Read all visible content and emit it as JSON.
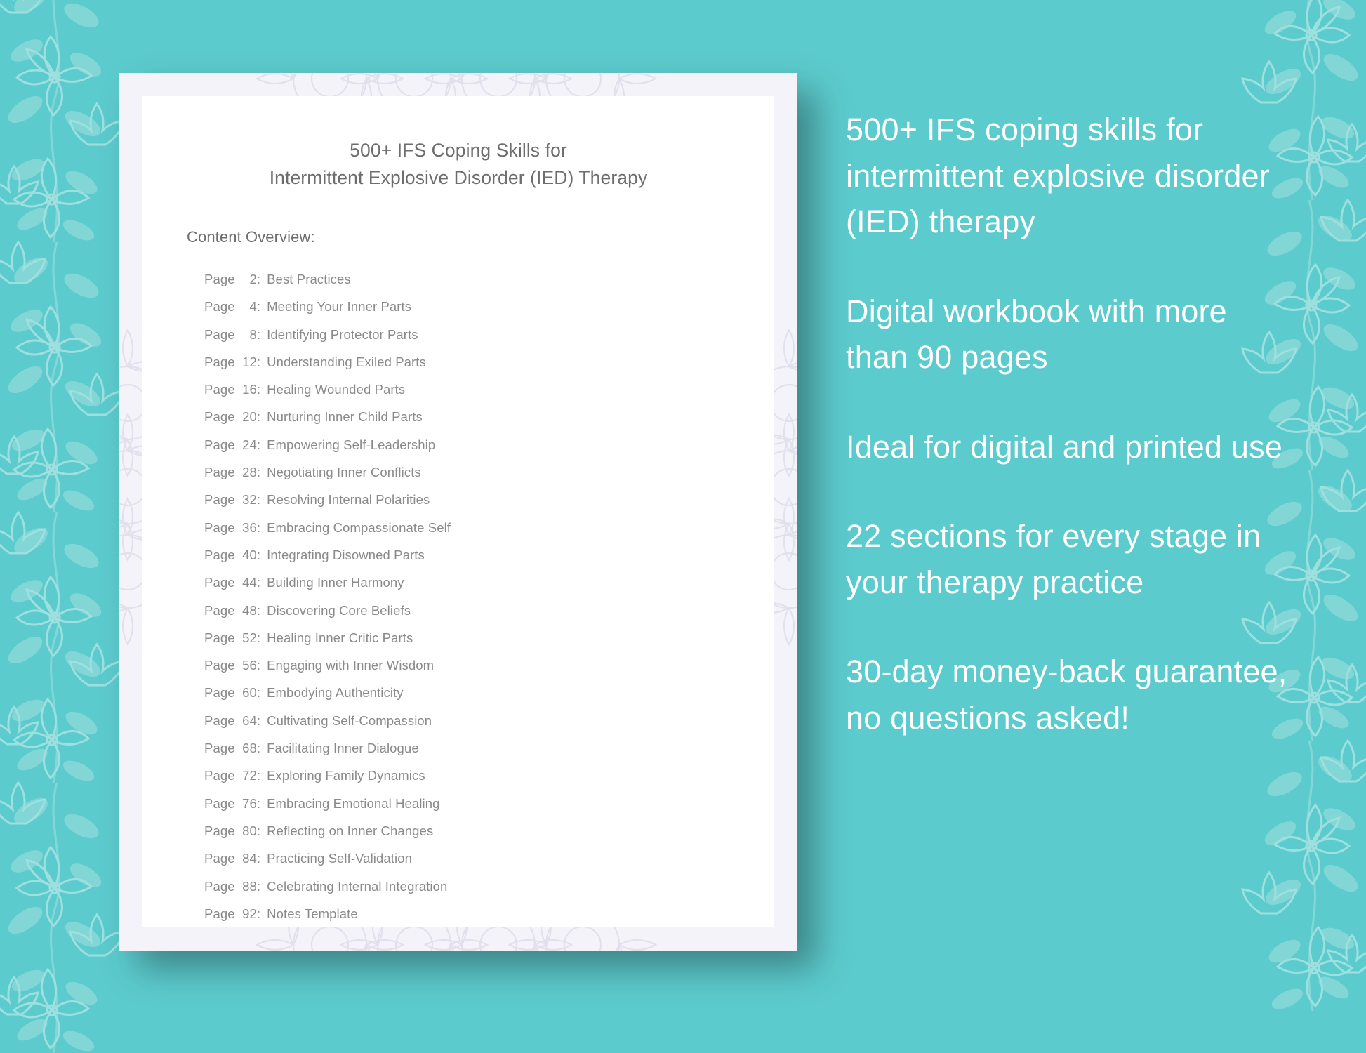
{
  "colors": {
    "background_teal": "#5ccbcd",
    "card_mat": "#f5f3fa",
    "page_white": "#ffffff",
    "title_text": "#6d6d6d",
    "toc_text": "#8a8a8a",
    "marketing_text": "#ffffff",
    "vine_ornament": "#a8e0de"
  },
  "document": {
    "title_line_1": "500+ IFS Coping Skills for",
    "title_line_2": "Intermittent Explosive Disorder (IED) Therapy",
    "content_overview_label": "Content Overview:",
    "toc": [
      {
        "page_label": "Page",
        "page": "2",
        "colon": ":",
        "title": "Best Practices"
      },
      {
        "page_label": "Page",
        "page": "4",
        "colon": ":",
        "title": "Meeting Your Inner Parts"
      },
      {
        "page_label": "Page",
        "page": "8",
        "colon": ":",
        "title": "Identifying Protector Parts"
      },
      {
        "page_label": "Page",
        "page": "12",
        "colon": ":",
        "title": "Understanding Exiled Parts"
      },
      {
        "page_label": "Page",
        "page": "16",
        "colon": ":",
        "title": "Healing Wounded Parts"
      },
      {
        "page_label": "Page",
        "page": "20",
        "colon": ":",
        "title": "Nurturing Inner Child Parts"
      },
      {
        "page_label": "Page",
        "page": "24",
        "colon": ":",
        "title": "Empowering Self-Leadership"
      },
      {
        "page_label": "Page",
        "page": "28",
        "colon": ":",
        "title": "Negotiating Inner Conflicts"
      },
      {
        "page_label": "Page",
        "page": "32",
        "colon": ":",
        "title": "Resolving Internal Polarities"
      },
      {
        "page_label": "Page",
        "page": "36",
        "colon": ":",
        "title": "Embracing Compassionate Self"
      },
      {
        "page_label": "Page",
        "page": "40",
        "colon": ":",
        "title": "Integrating Disowned Parts"
      },
      {
        "page_label": "Page",
        "page": "44",
        "colon": ":",
        "title": "Building Inner Harmony"
      },
      {
        "page_label": "Page",
        "page": "48",
        "colon": ":",
        "title": "Discovering Core Beliefs"
      },
      {
        "page_label": "Page",
        "page": "52",
        "colon": ":",
        "title": "Healing Inner Critic Parts"
      },
      {
        "page_label": "Page",
        "page": "56",
        "colon": ":",
        "title": "Engaging with Inner Wisdom"
      },
      {
        "page_label": "Page",
        "page": "60",
        "colon": ":",
        "title": "Embodying Authenticity"
      },
      {
        "page_label": "Page",
        "page": "64",
        "colon": ":",
        "title": "Cultivating Self-Compassion"
      },
      {
        "page_label": "Page",
        "page": "68",
        "colon": ":",
        "title": "Facilitating Inner Dialogue"
      },
      {
        "page_label": "Page",
        "page": "72",
        "colon": ":",
        "title": "Exploring Family Dynamics"
      },
      {
        "page_label": "Page",
        "page": "76",
        "colon": ":",
        "title": "Embracing Emotional Healing"
      },
      {
        "page_label": "Page",
        "page": "80",
        "colon": ":",
        "title": "Reflecting on Inner Changes"
      },
      {
        "page_label": "Page",
        "page": "84",
        "colon": ":",
        "title": "Practicing Self-Validation"
      },
      {
        "page_label": "Page",
        "page": "88",
        "colon": ":",
        "title": "Celebrating Internal Integration"
      },
      {
        "page_label": "Page",
        "page": "92",
        "colon": ":",
        "title": "Notes Template"
      }
    ]
  },
  "marketing": {
    "blocks": [
      "500+ IFS coping skills for intermittent explosive disorder (IED) therapy",
      "Digital workbook with more than 90 pages",
      "Ideal for digital and printed use",
      "22 sections for every stage in your therapy practice",
      "30-day money-back guarantee, no questions asked!"
    ]
  }
}
